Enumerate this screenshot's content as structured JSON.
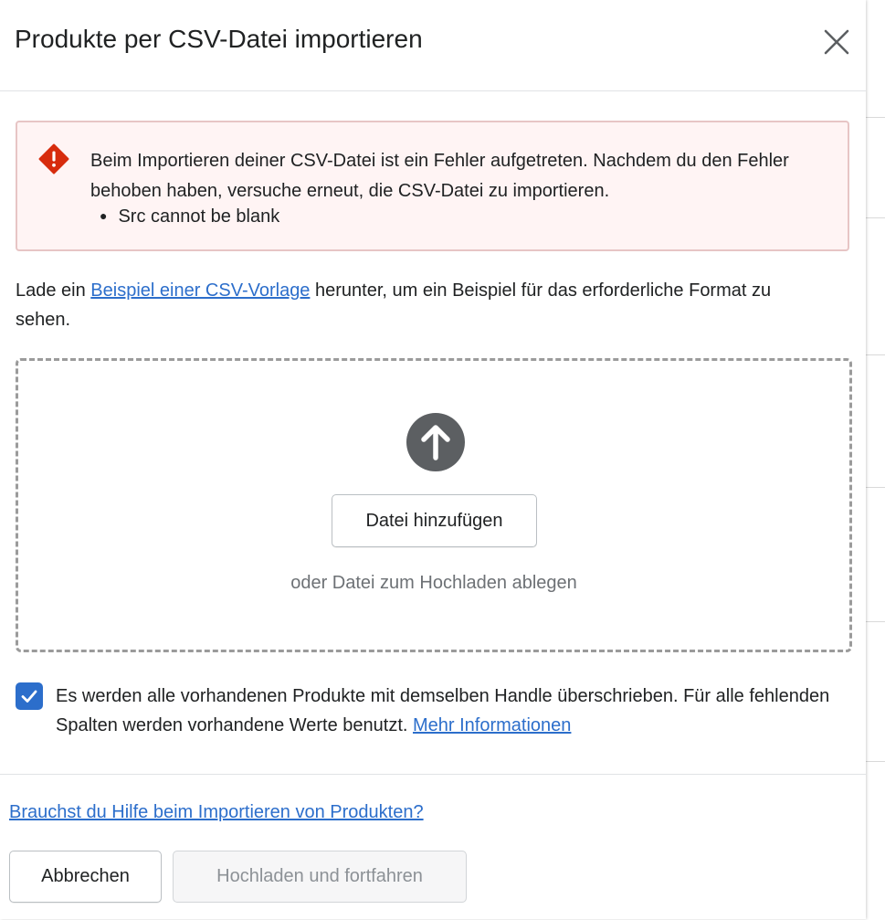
{
  "modal": {
    "title": "Produkte per CSV-Datei importieren"
  },
  "error_banner": {
    "message": "Beim Importieren deiner CSV-Datei ist ein Fehler aufgetreten. Nachdem du den Fehler behoben haben, versuche erneut, die CSV-Datei zu importieren.",
    "errors": [
      "Src cannot be blank"
    ],
    "color": "#d72c0d"
  },
  "intro": {
    "before": "Lade ein ",
    "link": "Beispiel einer CSV-Vorlage",
    "after": " herunter, um ein Beispiel für das erforderliche Format zu sehen."
  },
  "dropzone": {
    "button_label": "Datei hinzufügen",
    "hint": "oder Datei zum Hochladen ablegen"
  },
  "overwrite": {
    "checked": true,
    "text": "Es werden alle vorhandenen Produkte mit demselben Handle überschrieben. Für alle fehlenden Spalten werden vorhandene Werte benutzt. ",
    "link": "Mehr Informationen"
  },
  "footer": {
    "help_link": "Brauchst du Hilfe beim Importieren von Produkten?",
    "cancel_label": "Abbrechen",
    "submit_label": "Hochladen und fortfahren"
  },
  "colors": {
    "accent": "#2c6ecb",
    "banner_bg": "#fff4f4",
    "icon_dark": "#5c5f62"
  }
}
